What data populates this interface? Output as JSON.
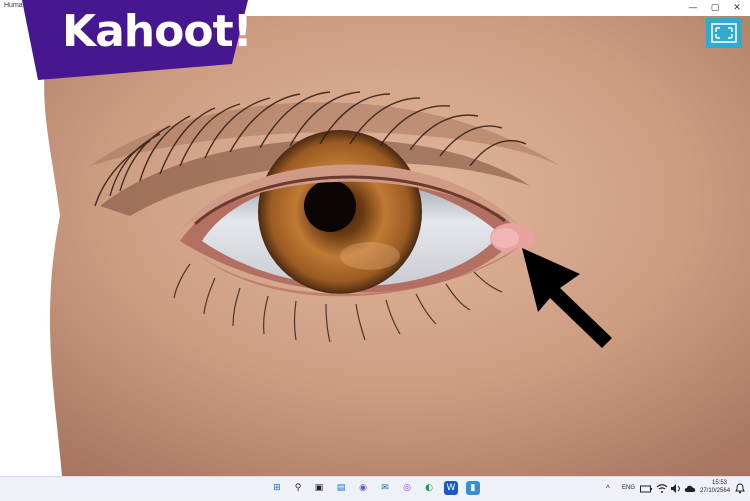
{
  "window": {
    "title": "Huma",
    "controls": {
      "minimize": "—",
      "maximize": "▢",
      "close": "✕"
    }
  },
  "kahoot": {
    "logo_text": "Kahoot!"
  },
  "taskbar": {
    "apps": [
      {
        "name": "start-button",
        "glyph": "⊞"
      },
      {
        "name": "search-button",
        "glyph": "⚲"
      },
      {
        "name": "task-view-button",
        "glyph": "▣"
      },
      {
        "name": "widgets-button",
        "glyph": "▤"
      },
      {
        "name": "chat-button",
        "glyph": "◉"
      },
      {
        "name": "mail-app",
        "glyph": "✉"
      },
      {
        "name": "messenger-app",
        "glyph": "◎"
      },
      {
        "name": "edge-app",
        "glyph": "◐"
      },
      {
        "name": "word-app",
        "glyph": "W"
      },
      {
        "name": "active-app",
        "glyph": "▮"
      }
    ],
    "tray": {
      "chevron": "^",
      "lang": "ENG",
      "clock_time": "15:53",
      "clock_date": "27/10/2564"
    }
  },
  "colors": {
    "kahoot_purple": "#46178f",
    "fullscreen_button": "#33aacc",
    "arrow": "#000000"
  }
}
